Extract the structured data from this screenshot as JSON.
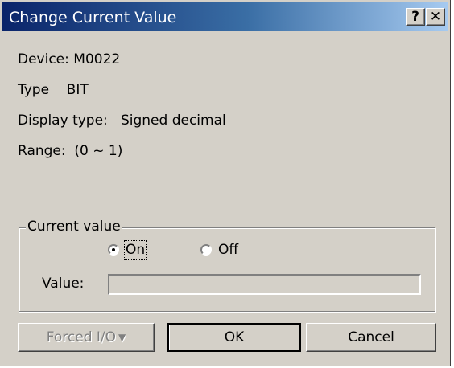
{
  "window": {
    "title": "Change Current Value",
    "help_glyph": "?",
    "close_glyph": "✕"
  },
  "info": {
    "device": "Device: M0022",
    "type": "Type    BIT",
    "display_type": "Display type:   Signed decimal",
    "range": "Range:  (0 ~ 1)"
  },
  "current_value": {
    "legend": "Current value",
    "on_label": "On",
    "off_label": "Off",
    "selected": "On",
    "value_label": "Value:",
    "value": ""
  },
  "buttons": {
    "forced_io": "Forced I/O",
    "forced_arrow": "▼",
    "ok": "OK",
    "cancel": "Cancel"
  },
  "colors": {
    "title_start": "#0a246a",
    "title_end": "#a6caf0",
    "face": "#d4d0c8"
  }
}
